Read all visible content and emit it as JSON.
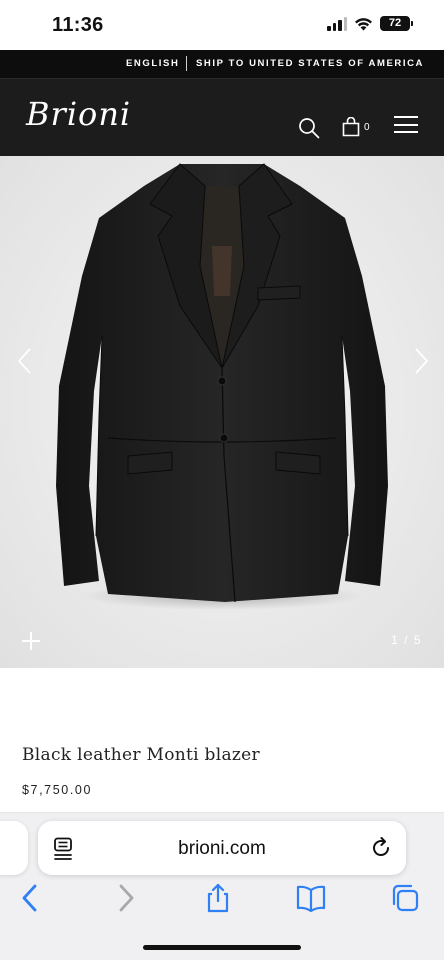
{
  "status_bar": {
    "time": "11:36",
    "battery": "72"
  },
  "utility_bar": {
    "language": "ENGLISH",
    "shipping": "SHIP TO UNITED STATES OF AMERICA"
  },
  "header": {
    "logo": "Brioni",
    "bag_count": "0",
    "icons": [
      "search-icon",
      "bag-icon",
      "menu-icon"
    ]
  },
  "gallery": {
    "counter": "1 / 5",
    "current_image": 1,
    "total_images": 5
  },
  "product": {
    "title": "Black leather Monti blazer",
    "price": "$7,750.00"
  },
  "browser": {
    "url": "brioni.com"
  },
  "colors": {
    "header_bg": "#1c1c1c",
    "utility_bg": "#0d0d0d",
    "gallery_bg": "#ececec",
    "ios_blue": "#2f7ff5"
  }
}
